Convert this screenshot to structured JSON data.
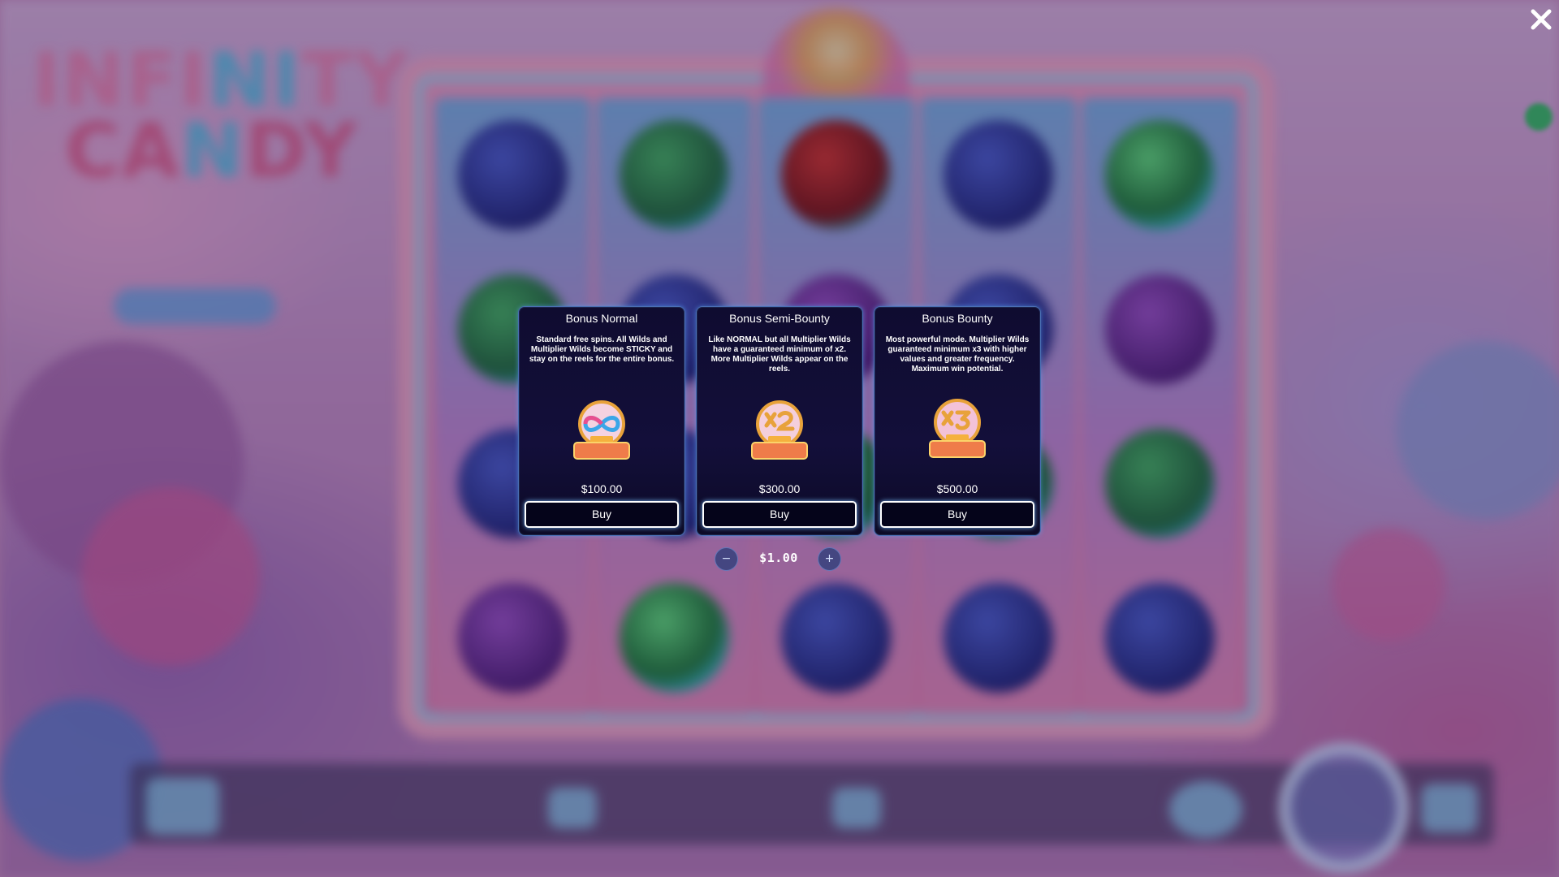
{
  "overlay": {
    "close_icon": "close-icon"
  },
  "bonus_options": [
    {
      "title": "Bonus Normal",
      "description": "Standard free spins. All Wilds and Multiplier Wilds become STICKY and stay on the reels for the entire bonus.",
      "icon": "wild-bonus-infinity-icon",
      "price": "$100.00",
      "buy_label": "Buy"
    },
    {
      "title": "Bonus Semi-Bounty",
      "description": "Like NORMAL but all Multiplier Wilds have a guaranteed minimum of x2. More Multiplier Wilds appear on the reels.",
      "icon": "wild-bonus-x2-icon",
      "price": "$300.00",
      "buy_label": "Buy"
    },
    {
      "title": "Bonus Bounty",
      "description": "Most powerful mode. Multiplier Wilds guaranteed minimum x3 with higher values and greater frequency. Maximum win potential.",
      "icon": "wild-bonus-x3-icon",
      "price": "$500.00",
      "buy_label": "Buy"
    }
  ],
  "bet": {
    "minus_label": "−",
    "plus_label": "+",
    "value": "$1.00"
  },
  "colors": {
    "card_bg": "#130f3a",
    "card_border": "#4a6fb3",
    "button_glow": "#78beff"
  }
}
